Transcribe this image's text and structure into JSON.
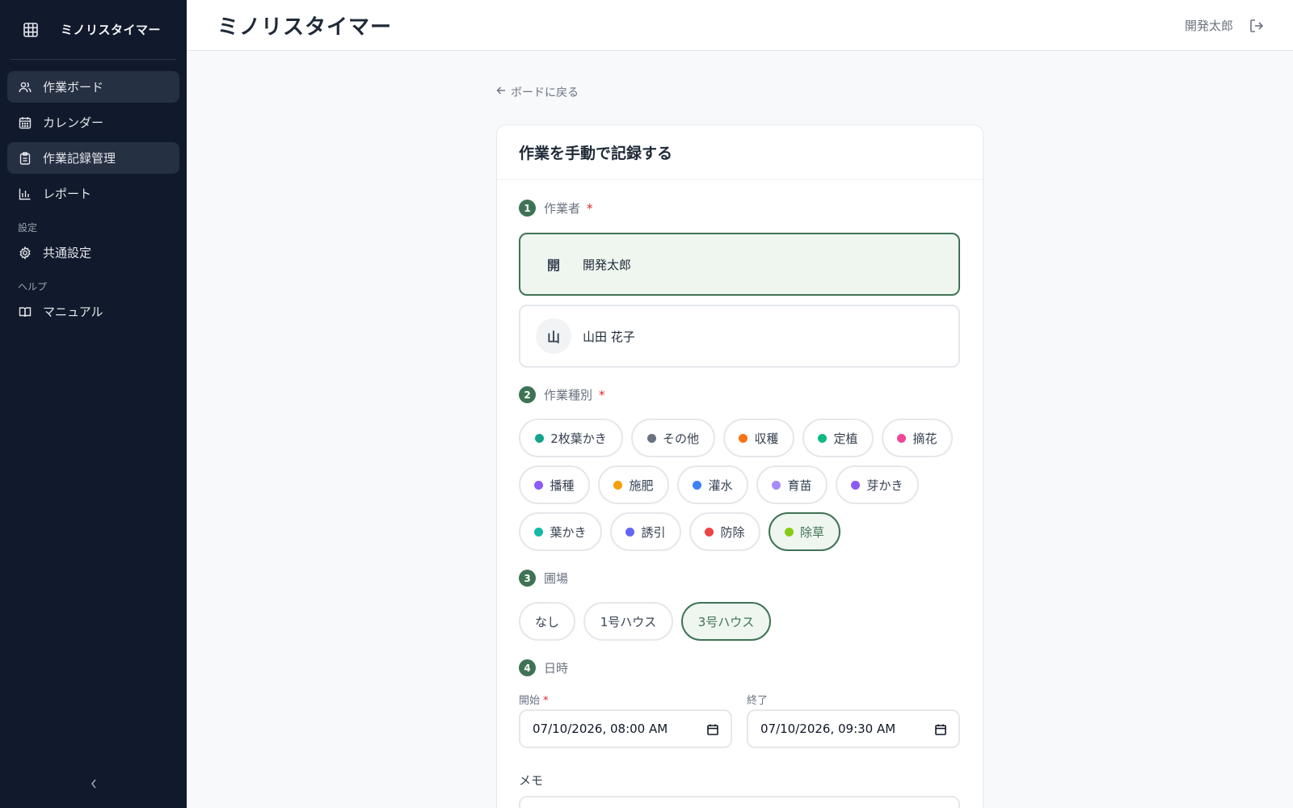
{
  "sidebar": {
    "brand": "ミノリスタイマー",
    "items": [
      {
        "label": "作業ボード",
        "icon": "users-icon"
      },
      {
        "label": "カレンダー",
        "icon": "calendar-icon"
      },
      {
        "label": "作業記録管理",
        "icon": "clipboard-icon"
      },
      {
        "label": "レポート",
        "icon": "bar-chart-icon"
      }
    ],
    "section_settings": "設定",
    "settings_item": "共通設定",
    "section_help": "ヘルプ",
    "help_item": "マニュアル"
  },
  "header": {
    "title": "ミノリスタイマー",
    "user_name": "開発太郎"
  },
  "back_link": "ボードに戻る",
  "form": {
    "title": "作業を手動で記録する",
    "required_mark": "*",
    "step1": {
      "num": "1",
      "label": "作業者"
    },
    "workers": [
      {
        "initial": "開",
        "name": "開発太郎",
        "selected": true
      },
      {
        "initial": "山",
        "name": "山田 花子",
        "selected": false
      }
    ],
    "step2": {
      "num": "2",
      "label": "作業種別"
    },
    "work_types": [
      {
        "label": "2枚葉かき",
        "color": "#14a38b"
      },
      {
        "label": "その他",
        "color": "#6b7280"
      },
      {
        "label": "収穫",
        "color": "#f97316"
      },
      {
        "label": "定植",
        "color": "#10b981"
      },
      {
        "label": "摘花",
        "color": "#ec4899"
      },
      {
        "label": "播種",
        "color": "#8b5cf6"
      },
      {
        "label": "施肥",
        "color": "#f59e0b"
      },
      {
        "label": "灌水",
        "color": "#3b82f6"
      },
      {
        "label": "育苗",
        "color": "#a78bfa"
      },
      {
        "label": "芽かき",
        "color": "#8b5cf6"
      },
      {
        "label": "葉かき",
        "color": "#14b8a6"
      },
      {
        "label": "誘引",
        "color": "#6366f1"
      },
      {
        "label": "防除",
        "color": "#ef4444"
      },
      {
        "label": "除草",
        "color": "#84cc16",
        "selected": true
      }
    ],
    "step3": {
      "num": "3",
      "label": "圃場"
    },
    "fields": [
      {
        "label": "なし"
      },
      {
        "label": "1号ハウス"
      },
      {
        "label": "3号ハウス",
        "selected": true
      }
    ],
    "step4": {
      "num": "4",
      "label": "日時"
    },
    "start_label": "開始",
    "end_label": "終了",
    "start_value": "07/10/2026, 08:00 AM",
    "end_value": "07/10/2026, 09:30 AM",
    "memo_label": "メモ"
  },
  "colors": {
    "sidebar_bg": "#111a2c",
    "accent_green": "#3f7355",
    "selected_bg": "#eef6ef",
    "required_red": "#dc2626"
  }
}
